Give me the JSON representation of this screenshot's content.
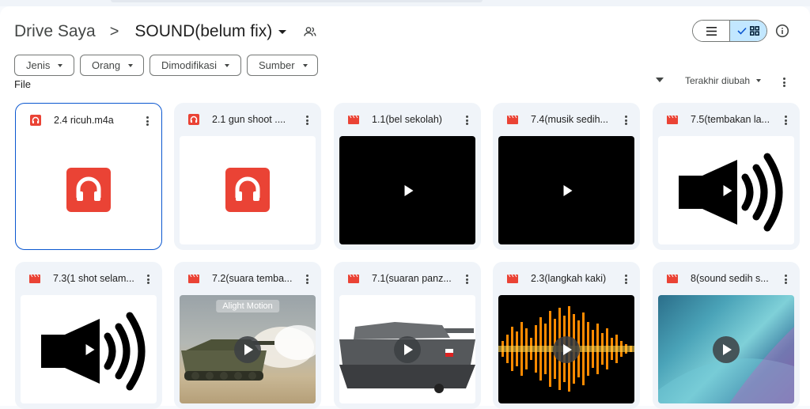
{
  "breadcrumb": {
    "root": "Drive Saya",
    "separator": ">",
    "current": "SOUND(belum fix)"
  },
  "filters": [
    "Jenis",
    "Orang",
    "Dimodifikasi",
    "Sumber"
  ],
  "section_label": "File",
  "sort_label": "Terakhir diubah",
  "view": {
    "mode": "grid"
  },
  "colors": {
    "accent": "#0b57d0",
    "audio_icon": "#ea4335",
    "video_icon": "#ea4335",
    "toggle_active": "#c2e7ff"
  },
  "files": [
    {
      "name": "2.4 ricuh.m4a",
      "type": "audio",
      "thumb": "audio-icon"
    },
    {
      "name": "2.1 gun shoot ....",
      "type": "audio",
      "thumb": "audio-icon"
    },
    {
      "name": "1.1(bel sekolah)",
      "type": "video",
      "thumb": "black"
    },
    {
      "name": "7.4(musik sedih...",
      "type": "video",
      "thumb": "black"
    },
    {
      "name": "7.5(tembakan la...",
      "type": "video",
      "thumb": "speaker"
    },
    {
      "name": "7.3(1 shot selam...",
      "type": "video",
      "thumb": "speaker"
    },
    {
      "name": "7.2(suara temba...",
      "type": "video",
      "thumb": "tank-fire",
      "overlay_text": "Alight Motion"
    },
    {
      "name": "7.1(suaran panz...",
      "type": "video",
      "thumb": "tank"
    },
    {
      "name": "2.3(langkah kaki)",
      "type": "video",
      "thumb": "waveform"
    },
    {
      "name": "8(sound sedih s...",
      "type": "video",
      "thumb": "abstract"
    }
  ]
}
